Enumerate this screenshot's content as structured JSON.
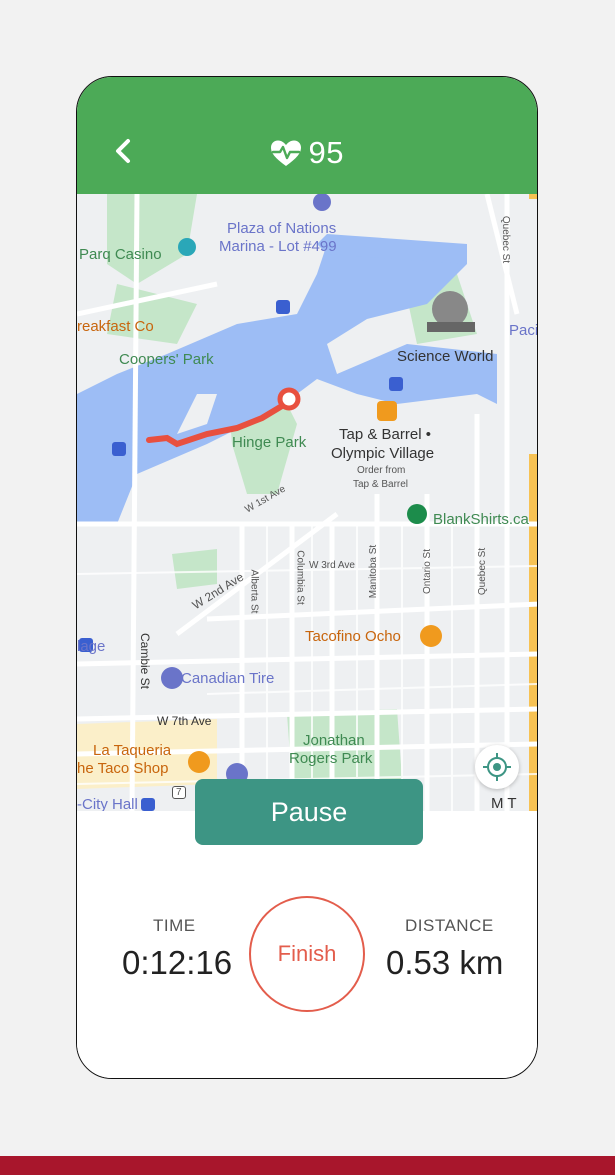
{
  "header": {
    "heart_rate": "95",
    "back_icon": "chevron-left-icon",
    "heart_icon": "heart-pulse-icon",
    "color": "#4caa57"
  },
  "map": {
    "labels": {
      "plaza": "Plaza of Nations",
      "marina": "Marina - Lot #499",
      "parq": "Parq Casino",
      "breakfast": "reakfast Co",
      "coopers": "Coopers' Park",
      "science": "Science World",
      "paci": "Paci",
      "hinge": "Hinge Park",
      "tap1": "Tap & Barrel •",
      "tap2": "Olympic Village",
      "tap3": "Order from",
      "tap4": "Tap & Barrel",
      "blankshirts": "BlankShirts.ca",
      "w1st": "W 1st Ave",
      "w2nd": "W 2nd Ave",
      "w3rd": "W 3rd Ave",
      "columbia": "Columbia St",
      "alberta": "Alberta St",
      "manitoba": "Manitoba St",
      "ontario": "Ontario St",
      "quebec": "Quebec St",
      "quebec_top": "Quebec St",
      "cambie": "Cambie St",
      "lage": "lage",
      "tacofino": "Tacofino Ocho",
      "canadian": "Canadian Tire",
      "w7th": "W 7th Ave",
      "taqueria1": "La Taqueria",
      "taqueria2": "he Taco Shop",
      "jonathan1": "Jonathan",
      "jonathan2": "Rogers Park",
      "cityhall": "-City Hall",
      "route7": "7",
      "mt": "M T"
    },
    "locate_icon": "crosshair-icon"
  },
  "controls": {
    "pause_label": "Pause",
    "finish_label": "Finish"
  },
  "stats": {
    "time_label": "TIME",
    "time_value": "0:12:16",
    "distance_label": "DISTANCE",
    "distance_value": "0.53 km"
  },
  "colors": {
    "accent": "#3d9584",
    "finish": "#e35d4c",
    "route": "#e8503f",
    "water": "#9dbdf5",
    "park": "#c5e6c9"
  }
}
